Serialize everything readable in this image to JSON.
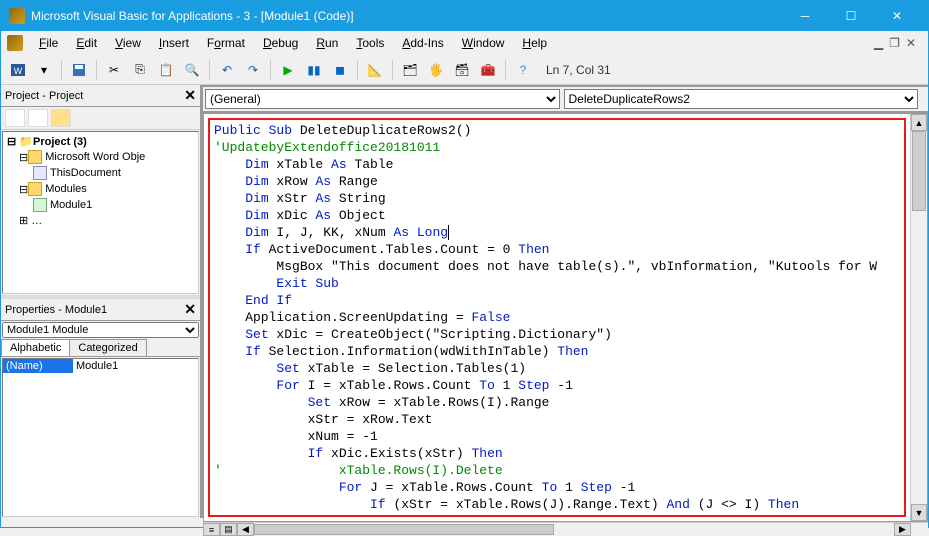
{
  "title": "Microsoft Visual Basic for Applications - 3 - [Module1 (Code)]",
  "menu": [
    "File",
    "Edit",
    "View",
    "Insert",
    "Format",
    "Debug",
    "Run",
    "Tools",
    "Add-Ins",
    "Window",
    "Help"
  ],
  "cursor_status": "Ln 7, Col 31",
  "project_panel": {
    "title": "Project - Project",
    "root": "Project (3)",
    "nodes": [
      {
        "label": "Microsoft Word Obje",
        "type": "fold"
      },
      {
        "label": "ThisDocument",
        "type": "doc"
      },
      {
        "label": "Modules",
        "type": "fold"
      },
      {
        "label": "Module1",
        "type": "mod"
      }
    ]
  },
  "properties_panel": {
    "title": "Properties - Module1",
    "combo": "Module1 Module",
    "tabs": [
      "Alphabetic",
      "Categorized"
    ],
    "row": {
      "name": "(Name)",
      "value": "Module1"
    }
  },
  "code_combos": {
    "left": "(General)",
    "right": "DeleteDuplicateRows2"
  },
  "code_lines": [
    {
      "t": "Public Sub",
      "k": 1,
      "r": " DeleteDuplicateRows2()"
    },
    {
      "t": "'UpdatebyExtendoffice20181011",
      "c": 1
    },
    {
      "i": 1,
      "t": "Dim",
      "k": 1,
      "r": " xTable ",
      "t2": "As",
      "r2": " Table"
    },
    {
      "i": 1,
      "t": "Dim",
      "k": 1,
      "r": " xRow ",
      "t2": "As",
      "r2": " Range"
    },
    {
      "i": 1,
      "t": "Dim",
      "k": 1,
      "r": " xStr ",
      "t2": "As",
      "r2": " String"
    },
    {
      "i": 1,
      "t": "Dim",
      "k": 1,
      "r": " xDic ",
      "t2": "As",
      "r2": " Object"
    },
    {
      "i": 1,
      "t": "Dim",
      "k": 1,
      "r": " I, J, KK, xNum ",
      "t2": "As Long",
      "cursor": 1
    },
    {
      "i": 1,
      "t": "If",
      "k": 1,
      "r": " ActiveDocument.Tables.Count = 0 ",
      "t2": "Then"
    },
    {
      "i": 2,
      "r": "MsgBox \"This document does not have table(s).\", vbInformation, \"Kutools for W"
    },
    {
      "i": 2,
      "t": "Exit Sub",
      "k": 1
    },
    {
      "i": 1,
      "t": "End If",
      "k": 1
    },
    {
      "i": 1,
      "r": "Application.ScreenUpdating = ",
      "t": "False",
      "k": 1,
      "pre": 1
    },
    {
      "i": 1,
      "t": "Set",
      "k": 1,
      "r": " xDic = CreateObject(\"Scripting.Dictionary\")"
    },
    {
      "i": 1,
      "t": "If",
      "k": 1,
      "r": " Selection.Information(wdWithInTable) ",
      "t2": "Then"
    },
    {
      "i": 2,
      "t": "Set",
      "k": 1,
      "r": " xTable = Selection.Tables(1)"
    },
    {
      "i": 2,
      "t": "For",
      "k": 1,
      "r": " I = xTable.Rows.Count ",
      "t2": "To",
      "r2": " 1 ",
      "t3": "Step",
      "r3": " -1"
    },
    {
      "i": 3,
      "t": "Set",
      "k": 1,
      "r": " xRow = xTable.Rows(I).Range"
    },
    {
      "i": 3,
      "r": "xStr = xRow.Text"
    },
    {
      "i": 3,
      "r": "xNum = -1"
    },
    {
      "i": 3,
      "t": "If",
      "k": 1,
      "r": " xDic.Exists(xStr) ",
      "t2": "Then"
    },
    {
      "cmline": "'               xTable.Rows(I).Delete"
    },
    {
      "i": 4,
      "t": "For",
      "k": 1,
      "r": " J = xTable.Rows.Count ",
      "t2": "To",
      "r2": " 1 ",
      "t3": "Step",
      "r3": " -1"
    },
    {
      "i": 5,
      "t": "If",
      "k": 1,
      "r": " (xStr = xTable.Rows(J).Range.Text) ",
      "t2": "And",
      "r2": " (J <> I) ",
      "t3": "Then"
    }
  ]
}
